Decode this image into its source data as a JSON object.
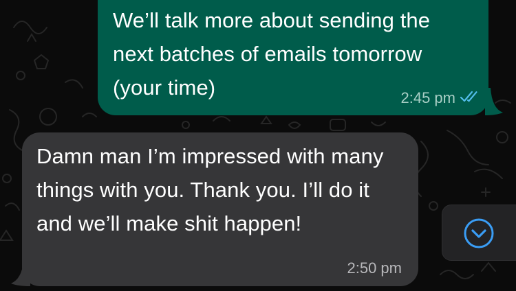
{
  "messages": [
    {
      "direction": "outgoing",
      "text": "We’ll talk more about sending the next batches of emails tomorrow (your time)",
      "time": "2:45 pm",
      "status": "read",
      "status_icon": "double-check-icon"
    },
    {
      "direction": "incoming",
      "text": "Damn man I’m impressed with many things with you. Thank you. I’ll do it and we’ll make shit happen!",
      "time": "2:50 pm"
    }
  ],
  "scroll_button": {
    "icon": "chevron-down-icon"
  },
  "colors": {
    "background": "#0b0b0b",
    "outgoing_bubble": "#005c4b",
    "incoming_bubble": "#363638",
    "accent_blue": "#3a9df5",
    "read_tick": "#53bdeb"
  }
}
